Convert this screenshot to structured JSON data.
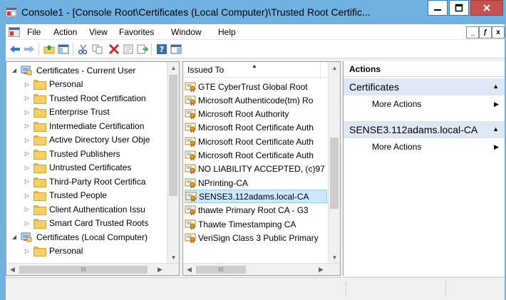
{
  "window": {
    "title": "Console1 - [Console Root\\Certificates (Local Computer)\\Trusted Root Certific...",
    "minimize_glyph": "–",
    "maximize_glyph": "□",
    "close_glyph": "x"
  },
  "menu": {
    "items": [
      "File",
      "Action",
      "View",
      "Favorites",
      "Window",
      "Help"
    ],
    "mdi_minimize": "_",
    "mdi_restore": "ƒ",
    "mdi_close": "x"
  },
  "toolbar": {
    "icons": [
      "back-icon",
      "forward-icon",
      "up-folder-icon",
      "show-hide-tree-icon",
      "cut-icon",
      "copy-icon",
      "delete-icon",
      "properties-icon",
      "export-icon",
      "help-icon",
      "show-hide-action-pane-icon"
    ]
  },
  "tree": {
    "items": [
      {
        "label": "Certificates - Current User",
        "level": 0,
        "expander": "◢",
        "icon": "computer"
      },
      {
        "label": "Personal",
        "level": 1,
        "expander": "▷",
        "icon": "folder"
      },
      {
        "label": "Trusted Root Certification",
        "level": 1,
        "expander": "▷",
        "icon": "folder"
      },
      {
        "label": "Enterprise Trust",
        "level": 1,
        "expander": "▷",
        "icon": "folder"
      },
      {
        "label": "Intermediate Certification",
        "level": 1,
        "expander": "▷",
        "icon": "folder"
      },
      {
        "label": "Active Directory User Obje",
        "level": 1,
        "expander": "▷",
        "icon": "folder"
      },
      {
        "label": "Trusted Publishers",
        "level": 1,
        "expander": "▷",
        "icon": "folder"
      },
      {
        "label": "Untrusted Certificates",
        "level": 1,
        "expander": "▷",
        "icon": "folder"
      },
      {
        "label": "Third-Party Root Certifica",
        "level": 1,
        "expander": "▷",
        "icon": "folder"
      },
      {
        "label": "Trusted People",
        "level": 1,
        "expander": "▷",
        "icon": "folder"
      },
      {
        "label": "Client Authentication Issu",
        "level": 1,
        "expander": "▷",
        "icon": "folder"
      },
      {
        "label": "Smart Card Trusted Roots",
        "level": 1,
        "expander": "▷",
        "icon": "folder"
      },
      {
        "label": "Certificates (Local Computer)",
        "level": 0,
        "expander": "◢",
        "icon": "computer"
      },
      {
        "label": "Personal",
        "level": 1,
        "expander": "▷",
        "icon": "folder"
      }
    ],
    "hscroll_grip": "III"
  },
  "list": {
    "column_header": "Issued To",
    "rows": [
      {
        "label": "GTE CyberTrust Global Root",
        "selected": false
      },
      {
        "label": "Microsoft Authenticode(tm) Ro",
        "selected": false
      },
      {
        "label": "Microsoft Root Authority",
        "selected": false
      },
      {
        "label": "Microsoft Root Certificate Auth",
        "selected": false
      },
      {
        "label": "Microsoft Root Certificate Auth",
        "selected": false
      },
      {
        "label": "Microsoft Root Certificate Auth",
        "selected": false
      },
      {
        "label": "NO LIABILITY ACCEPTED, (c)97",
        "selected": false
      },
      {
        "label": "NPrinting-CA",
        "selected": false
      },
      {
        "label": "SENSE3.112adams.local-CA",
        "selected": true
      },
      {
        "label": "thawte Primary Root CA - G3",
        "selected": false
      },
      {
        "label": "Thawte Timestamping CA",
        "selected": false
      },
      {
        "label": "VeriSign Class 3 Public Primary",
        "selected": false
      }
    ],
    "hscroll_grip": "III"
  },
  "actions": {
    "header": "Actions",
    "groups": [
      {
        "title": "Certificates",
        "item": "More Actions"
      },
      {
        "title": "SENSE3.112adams.local-CA",
        "item": "More Actions"
      }
    ]
  },
  "colors": {
    "title_bar": "#6fb1e0",
    "selected_row": "#cce8ff",
    "action_group": "#dde8f4",
    "close_button": "#c75050"
  }
}
